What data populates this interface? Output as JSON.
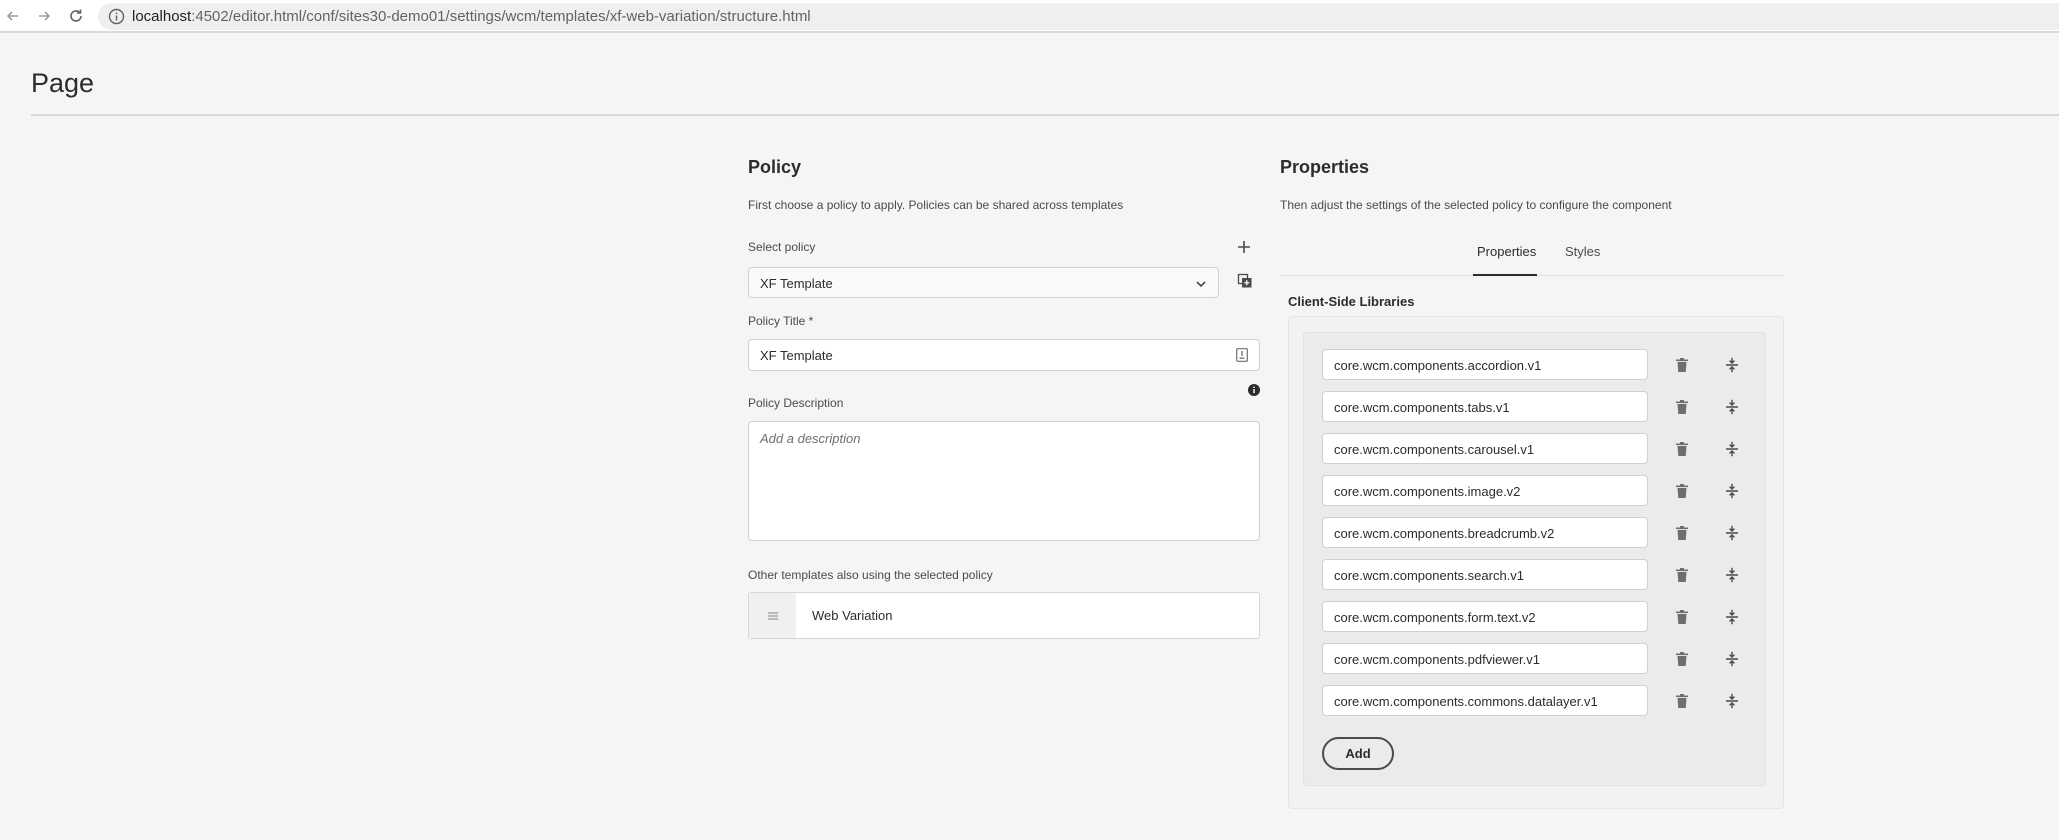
{
  "browser": {
    "url_host": "localhost",
    "url_path": ":4502/editor.html/conf/sites30-demo01/settings/wcm/templates/xf-web-variation/structure.html"
  },
  "page": {
    "title": "Page"
  },
  "policy": {
    "title": "Policy",
    "description": "First choose a policy to apply. Policies can be shared across templates",
    "select_label": "Select policy",
    "selected_policy": "XF Template",
    "title_label": "Policy Title *",
    "title_value": "XF Template",
    "description_label": "Policy Description",
    "description_placeholder": "Add a description",
    "other_templates_label": "Other templates also using the selected policy",
    "other_templates": [
      "Web Variation"
    ]
  },
  "properties": {
    "title": "Properties",
    "description": "Then adjust the settings of the selected policy to configure the component",
    "tabs": [
      {
        "label": "Properties",
        "active": true
      },
      {
        "label": "Styles",
        "active": false
      }
    ],
    "group_title": "Client-Side Libraries",
    "libraries": [
      "core.wcm.components.accordion.v1",
      "core.wcm.components.tabs.v1",
      "core.wcm.components.carousel.v1",
      "core.wcm.components.image.v2",
      "core.wcm.components.breadcrumb.v2",
      "core.wcm.components.search.v1",
      "core.wcm.components.form.text.v2",
      "core.wcm.components.pdfviewer.v1",
      "core.wcm.components.commons.datalayer.v1"
    ],
    "add_label": "Add"
  },
  "icons": {
    "back": "arrow-left-icon",
    "forward": "arrow-right-icon",
    "reload": "reload-icon",
    "info": "info-icon",
    "add": "plus-icon",
    "copy": "copy-icon",
    "delete": "trash-icon",
    "reorder": "drag-handle-icon"
  }
}
